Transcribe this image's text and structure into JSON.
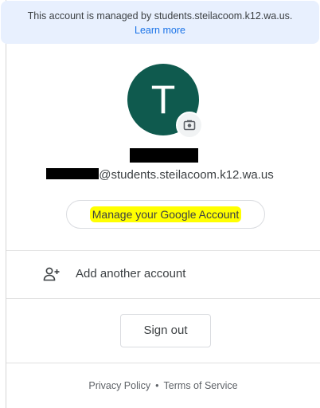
{
  "banner": {
    "text": "This account is managed by students.steilacoom.k12.wa.us.",
    "link": "Learn more"
  },
  "profile": {
    "initial": "T",
    "email_suffix": "@students.steilacoom.k12.wa.us",
    "avatar_color": "#0f5a4e",
    "camera_icon": "camera-icon"
  },
  "manage_button": {
    "label": "Manage your Google Account",
    "highlight_color": "#ffff00"
  },
  "add_account": {
    "label": "Add another account",
    "icon": "person-add-icon"
  },
  "sign_out": {
    "label": "Sign out"
  },
  "footer": {
    "privacy": "Privacy Policy",
    "separator": "•",
    "terms": "Terms of Service"
  },
  "colors": {
    "banner_bg": "#e8f0fe",
    "link": "#1a73e8",
    "text": "#3c4043"
  }
}
